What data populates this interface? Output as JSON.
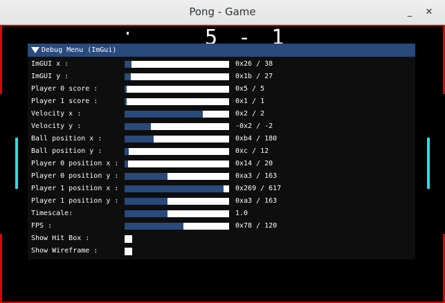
{
  "window": {
    "title": "Pong - Game",
    "minimize_icon": "minimize-icon",
    "close_icon": "close-icon",
    "minimize_glyph": "_",
    "close_glyph": "✕"
  },
  "game": {
    "score": "5 - 1",
    "colors": {
      "wall": "#e00000",
      "paddle": "#23e0f0",
      "background": "#000000"
    }
  },
  "debug_menu": {
    "title": "Debug Menu (ImGui)",
    "header_color": "#294a7a",
    "rows": [
      {
        "label": "ImGUI x :",
        "value": "0x26 / 38",
        "fraction": 0.0647
      },
      {
        "label": "ImGUI y :",
        "value": "0x1b / 27",
        "fraction": 0.0616
      },
      {
        "label": "Player 0 score :",
        "value": "0x5 / 5",
        "fraction": 0.01
      },
      {
        "label": "Player 1 score :",
        "value": "0x1 / 1",
        "fraction": 0.01
      },
      {
        "label": "Velocity x :",
        "value": "0x2 / 2",
        "fraction": 0.75
      },
      {
        "label": "Velocity y :",
        "value": "-0x2 / -2",
        "fraction": 0.25
      },
      {
        "label": "Ball position x :",
        "value": "0xb4 / 180",
        "fraction": 0.28
      },
      {
        "label": "Ball position y :",
        "value": "0xc / 12",
        "fraction": 0.04
      },
      {
        "label": "Player 0 position x :",
        "value": "0x14 / 20",
        "fraction": 0.034
      },
      {
        "label": "Player 0 position y :",
        "value": "0xa3 / 163",
        "fraction": 0.41
      },
      {
        "label": "Player 1 position x :",
        "value": "0x269 / 617",
        "fraction": 0.95
      },
      {
        "label": "Player 1 position y :",
        "value": "0xa3 / 163",
        "fraction": 0.41
      },
      {
        "label": "Timescale:",
        "value": "1.0",
        "fraction": 0.41
      },
      {
        "label": "FPS :",
        "value": "0x78 / 120",
        "fraction": 0.56
      }
    ],
    "checkboxes": [
      {
        "label": "Show Hit Box :",
        "checked": false
      },
      {
        "label": "Show Wireframe :",
        "checked": false
      }
    ]
  }
}
